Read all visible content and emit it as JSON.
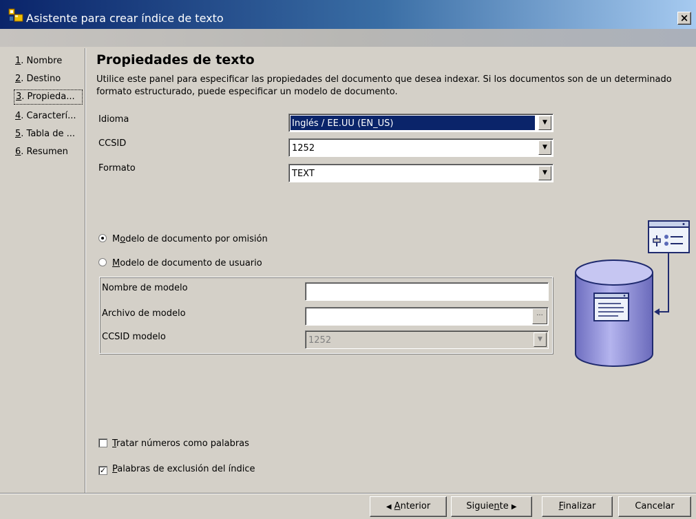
{
  "window": {
    "title": "Asistente para crear índice de texto",
    "close_label": "×"
  },
  "sidebar": {
    "items": [
      {
        "num": "1",
        "label": ". Nombre"
      },
      {
        "num": "2",
        "label": ". Destino"
      },
      {
        "num": "3",
        "label": ". Propieda..."
      },
      {
        "num": "4",
        "label": ". Caracterí..."
      },
      {
        "num": "5",
        "label": ". Tabla de ..."
      },
      {
        "num": "6",
        "label": ". Resumen"
      }
    ]
  },
  "main": {
    "title": "Propiedades de texto",
    "description": "Utilice este panel para especificar las propiedades del documento que desea indexar. Si los documentos son de un determinado formato estructurado, puede especificar un modelo de documento.",
    "fields": {
      "idioma": {
        "label": "Idioma",
        "value": "Inglés / EE.UU (EN_US)"
      },
      "ccsid": {
        "label": "CCSID",
        "value": "1252"
      },
      "formato": {
        "label": "Formato",
        "value": "TEXT"
      }
    },
    "radios": {
      "default_model": {
        "pre": "M",
        "mnemonic": "o",
        "post": "delo de documento por omisión",
        "checked": true
      },
      "user_model": {
        "pre": "",
        "mnemonic": "M",
        "post": "odelo de documento de usuario",
        "checked": false
      }
    },
    "model": {
      "name_label": "Nombre de modelo",
      "name_value": "",
      "file_label": "Archivo de modelo",
      "file_value": "",
      "browse_label": "...",
      "ccsid_label": "CCSID modelo",
      "ccsid_value": "1252"
    },
    "checkboxes": {
      "numbers_as_words": {
        "mnemonic": "T",
        "post": "ratar números como palabras",
        "checked": false
      },
      "stop_words": {
        "mnemonic": "P",
        "post": "alabras de exclusión del índice",
        "checked": true
      }
    }
  },
  "buttons": {
    "back": {
      "arrow": "◀",
      "mnemonic": "A",
      "post": "nterior"
    },
    "next": {
      "pre": "Siguie",
      "mnemonic": "n",
      "post": "te",
      "arrow": "▶"
    },
    "finish": {
      "mnemonic": "F",
      "post": "inalizar"
    },
    "cancel": {
      "label": "Cancelar"
    }
  },
  "combo_arrow": "▼",
  "check_mark": "✓",
  "colors": {
    "titlebar_start": "#0a246a",
    "titlebar_end": "#a6caf0",
    "selection": "#0a246a",
    "dialog_face": "#d4d0c8",
    "illustration_cylinder": "#9d9ddc",
    "illustration_line": "#1f2a6e"
  }
}
